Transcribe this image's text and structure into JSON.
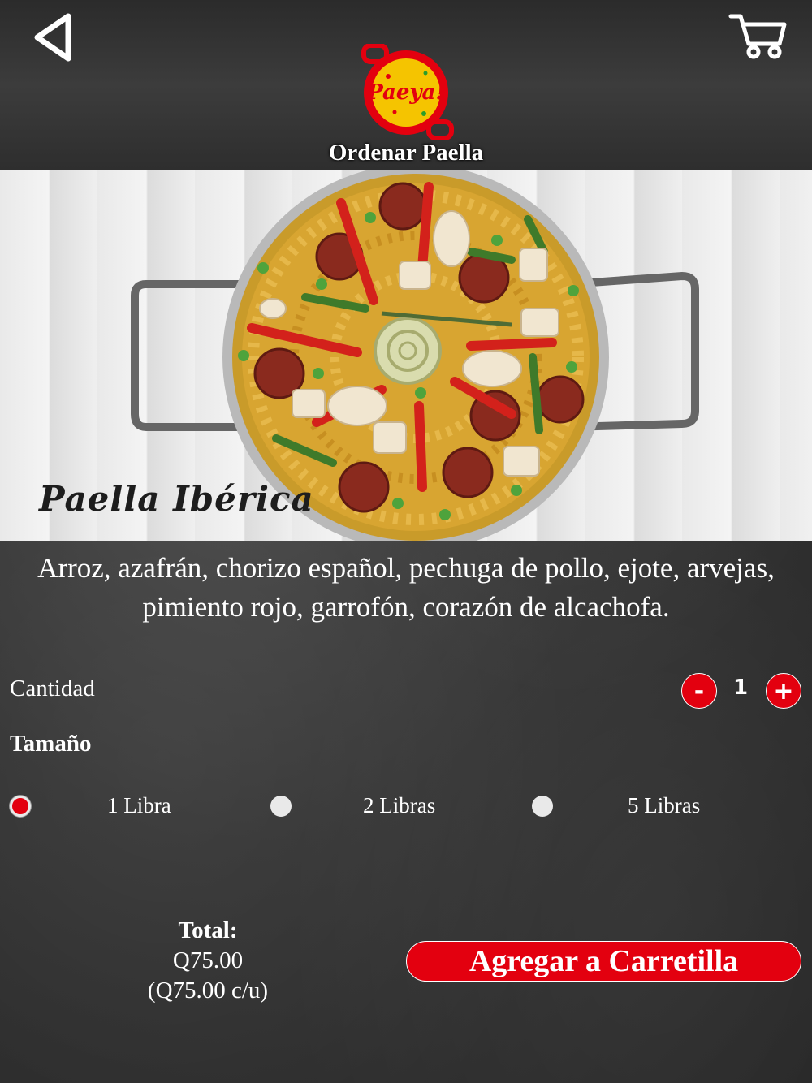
{
  "header": {
    "title": "Ordenar Paella",
    "logo_text": "Paeya!",
    "back_icon": "back-arrow-icon",
    "cart_icon": "shopping-cart-icon"
  },
  "product": {
    "image_caption": "Paella Ibérica",
    "description": "Arroz, azafrán, chorizo español, pechuga de pollo, ejote, arvejas, pimiento rojo, garrofón, corazón de alcachofa."
  },
  "quantity": {
    "label": "Cantidad",
    "value": "1",
    "minus_label": "-",
    "plus_label": "+"
  },
  "size": {
    "title": "Tamaño",
    "options": [
      {
        "label": "1 Libra",
        "selected": true
      },
      {
        "label": "2 Libras",
        "selected": false
      },
      {
        "label": "5 Libras",
        "selected": false
      }
    ]
  },
  "total": {
    "title": "Total:",
    "amount": "Q75.00",
    "unit_price": "(Q75.00 c/u)"
  },
  "actions": {
    "add_to_cart_label": "Agregar a Carretilla"
  },
  "colors": {
    "accent_red": "#e3000f",
    "logo_yellow": "#f5c400",
    "background": "#333333"
  }
}
